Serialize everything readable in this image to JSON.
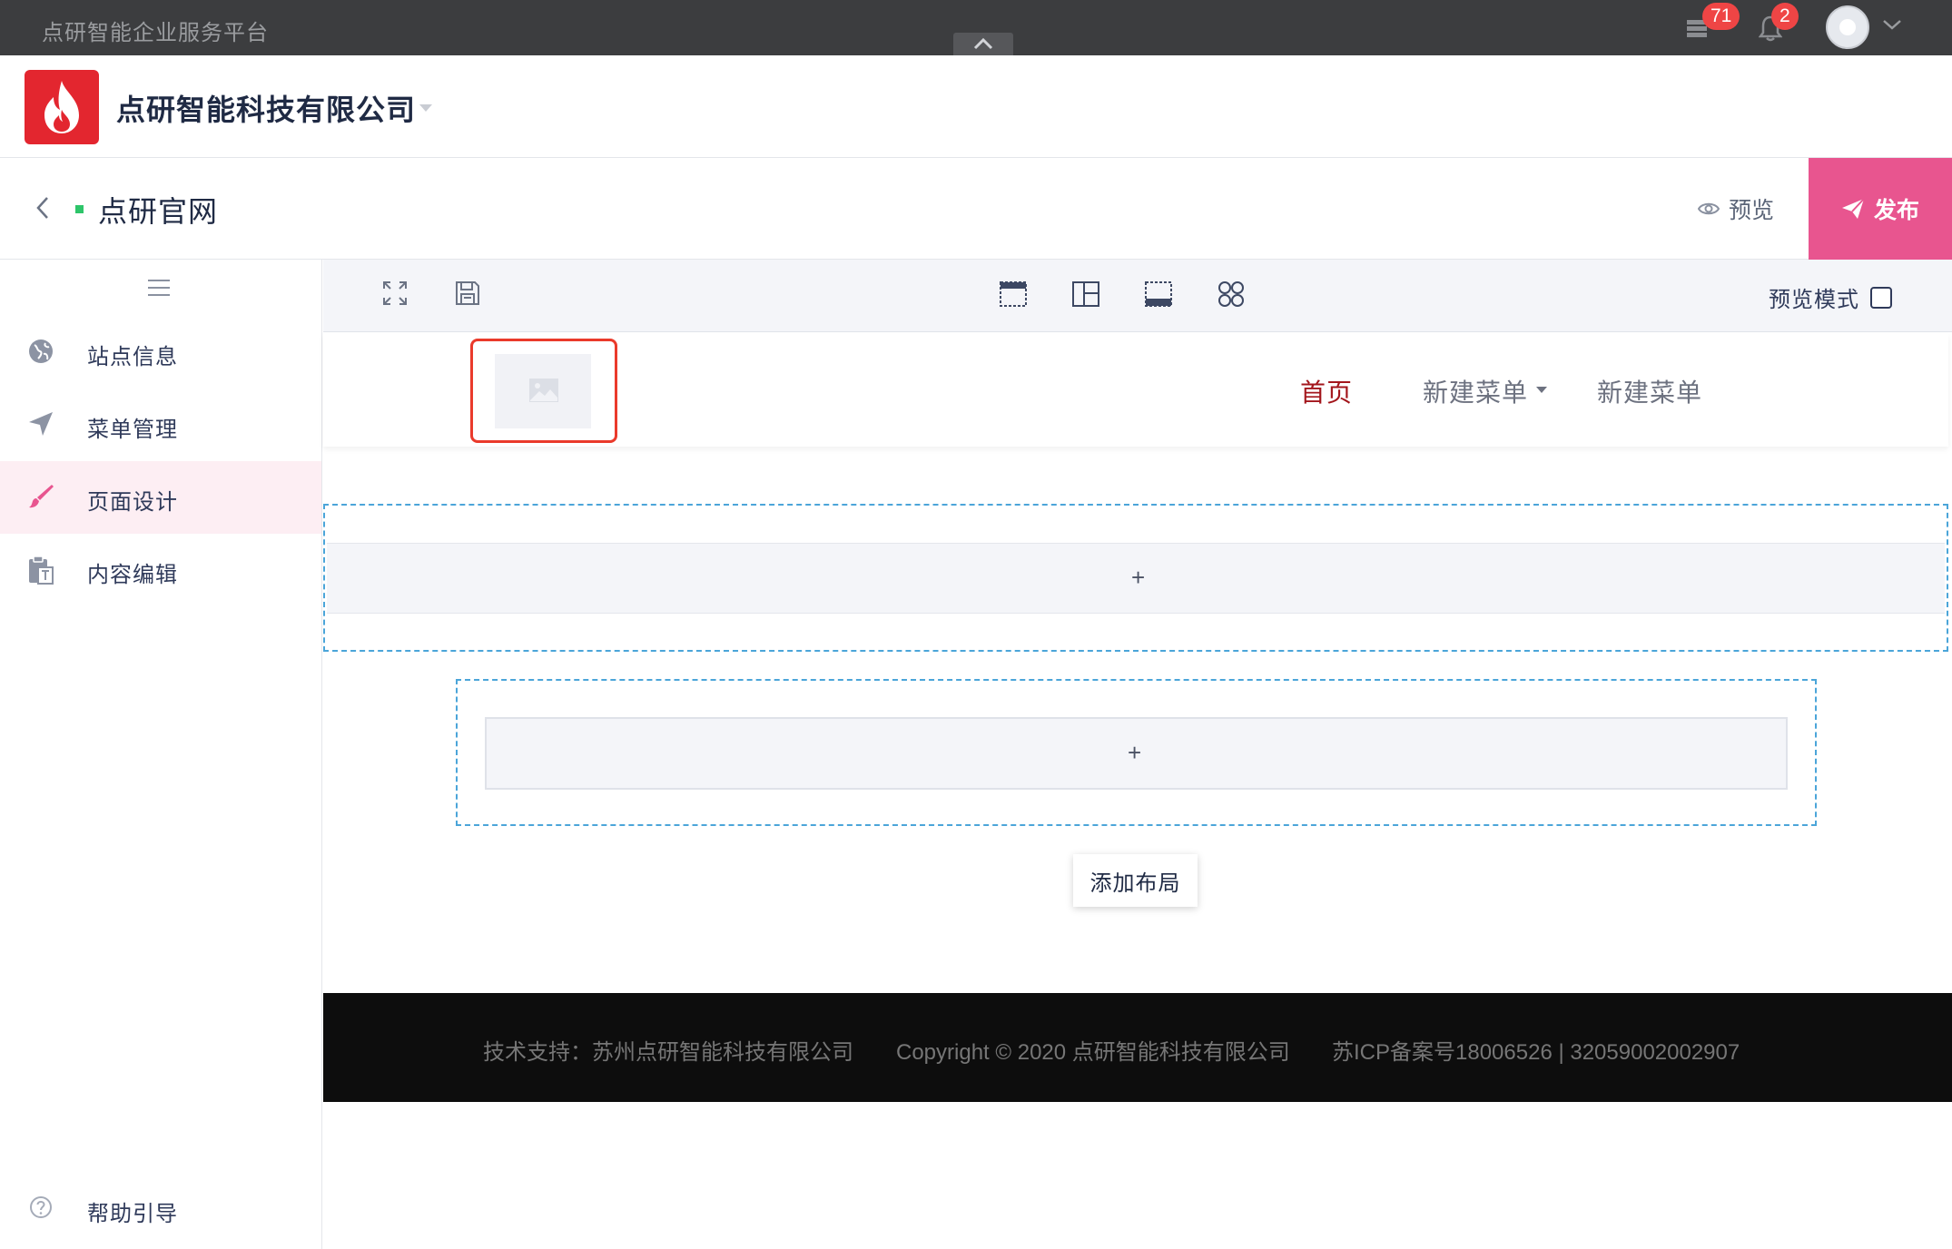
{
  "topbar": {
    "platform_title": "点研智能企业服务平台",
    "notifications": [
      {
        "icon": "stack-icon",
        "count": "71"
      },
      {
        "icon": "bell-icon",
        "count": "2"
      }
    ]
  },
  "company": {
    "name": "点研智能科技有限公司"
  },
  "site": {
    "title": "点研官网",
    "status_color": "#2ec56a",
    "preview_label": "预览",
    "publish_label": "发布"
  },
  "sidebar": {
    "items": [
      {
        "label": "站点信息",
        "icon": "globe-icon",
        "active": false
      },
      {
        "label": "菜单管理",
        "icon": "navigation-icon",
        "active": false
      },
      {
        "label": "页面设计",
        "icon": "brush-icon",
        "active": true
      },
      {
        "label": "内容编辑",
        "icon": "clipboard-text-icon",
        "active": false
      }
    ],
    "help_label": "帮助引导"
  },
  "toolbar": {
    "left_tools": [
      "fullscreen-icon",
      "save-icon"
    ],
    "layout_tools": [
      "header-layout-icon",
      "column-layout-icon",
      "footer-layout-icon",
      "module-grid-icon"
    ],
    "preview_mode_label": "预览模式",
    "preview_mode_checked": false
  },
  "canvas": {
    "nav": {
      "items": [
        "首页",
        "新建菜单",
        "新建菜单"
      ],
      "current_index": 0
    },
    "section_plus": "+",
    "add_layout_label": "添加布局",
    "footer": {
      "support": "技术支持：苏州点研智能科技有限公司",
      "copyright": "Copyright © 2020 点研智能科技有限公司",
      "icp": "苏ICP备案号18006526 | 32059002002907"
    }
  },
  "colors": {
    "accent_pink": "#e8558f",
    "brand_red": "#e3262f",
    "badge_red": "#ef4545",
    "selection_red": "#ea3a2b",
    "nav_current": "#a3161c",
    "dashed_blue": "#4ba5d9"
  }
}
